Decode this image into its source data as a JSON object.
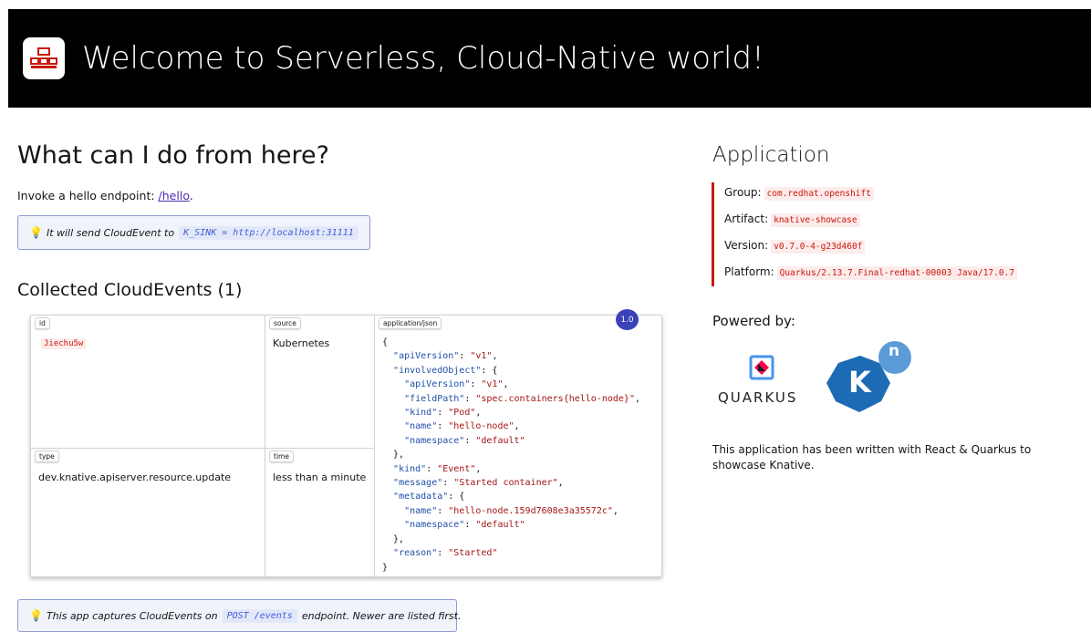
{
  "header": {
    "title": "Welcome to Serverless, Cloud-Native world!",
    "logo_icon": "logo-icon"
  },
  "main": {
    "heading": "What can I do from here?",
    "invoke_text": "Invoke a hello endpoint: ",
    "invoke_link": "/hello",
    "invoke_suffix": ".",
    "sink_note": {
      "before": "It will send CloudEvent to",
      "code": "K_SINK = http://localhost:31111"
    },
    "events_heading": "Collected CloudEvents (1)",
    "event": {
      "version_badge": "1.0",
      "id_label": "id",
      "id_value": "Jiechu5w",
      "source_label": "source",
      "source_value": "Kubernetes",
      "type_label": "type",
      "type_value": "dev.knative.apiserver.resource.update",
      "time_label": "time",
      "time_value": "less than a minute",
      "json_label": "application/json"
    },
    "capture_note": {
      "before": "This app captures CloudEvents on",
      "code": "POST /events",
      "after": "endpoint. Newer are listed first."
    }
  },
  "sidebar": {
    "app_heading": "Application",
    "group_label": "Group:",
    "group_value": "com.redhat.openshift",
    "artifact_label": "Artifact:",
    "artifact_value": "knative-showcase",
    "version_label": "Version:",
    "version_value": "v0.7.0-4-g23d460f",
    "platform_label": "Platform:",
    "platform_value": "Quarkus/2.13.7.Final-redhat-00003 Java/17.0.7",
    "powered_heading": "Powered by:",
    "quarkus_label": "QUARKUS",
    "knative_letter": "K",
    "knative_sup": "n",
    "description": "This application has been written with React & Quarkus to showcase Knative."
  },
  "colors": {
    "header_bg": "#000000",
    "accent_red": "#c9190b",
    "note_border": "#8f9bd1",
    "badge": "#3b42b8",
    "knative_blue": "#1d6bb5"
  }
}
